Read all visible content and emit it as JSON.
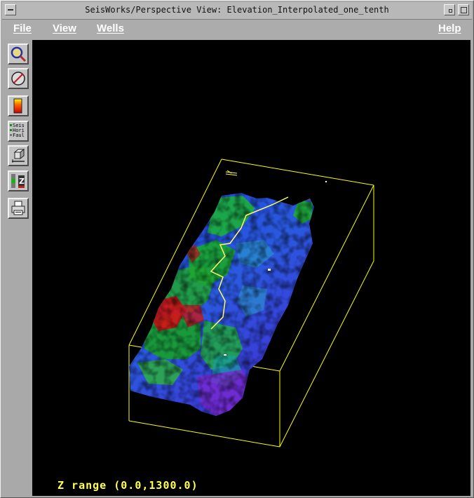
{
  "window": {
    "title": "SeisWorks/Perspective View: Elevation_Interpolated_one_tenth"
  },
  "menu": {
    "file": "File",
    "view": "View",
    "wells": "Wells",
    "help": "Help"
  },
  "toolbar": {
    "tools": [
      {
        "name": "zoom-tool",
        "icon": "magnifier-icon"
      },
      {
        "name": "rotate-tool",
        "icon": "compass-rotate-icon"
      },
      {
        "name": "colorbar-tool",
        "icon": "colorbar-icon"
      },
      {
        "name": "data-selection-tool",
        "icon": "seis-hori-faul-legend-icon"
      },
      {
        "name": "view-box-tool",
        "icon": "cube-icon"
      },
      {
        "name": "z-scale-tool",
        "icon": "z-scale-icon"
      },
      {
        "name": "print-tool",
        "icon": "printer-icon"
      }
    ],
    "legend_lines": [
      "Seis",
      "Hori",
      "Faul"
    ]
  },
  "viewport": {
    "z_range_text": "Z range (0.0,1300.0)"
  },
  "colors": {
    "bounding_box": "#ffff00",
    "well_path": "#ffff66",
    "background": "#000000"
  }
}
